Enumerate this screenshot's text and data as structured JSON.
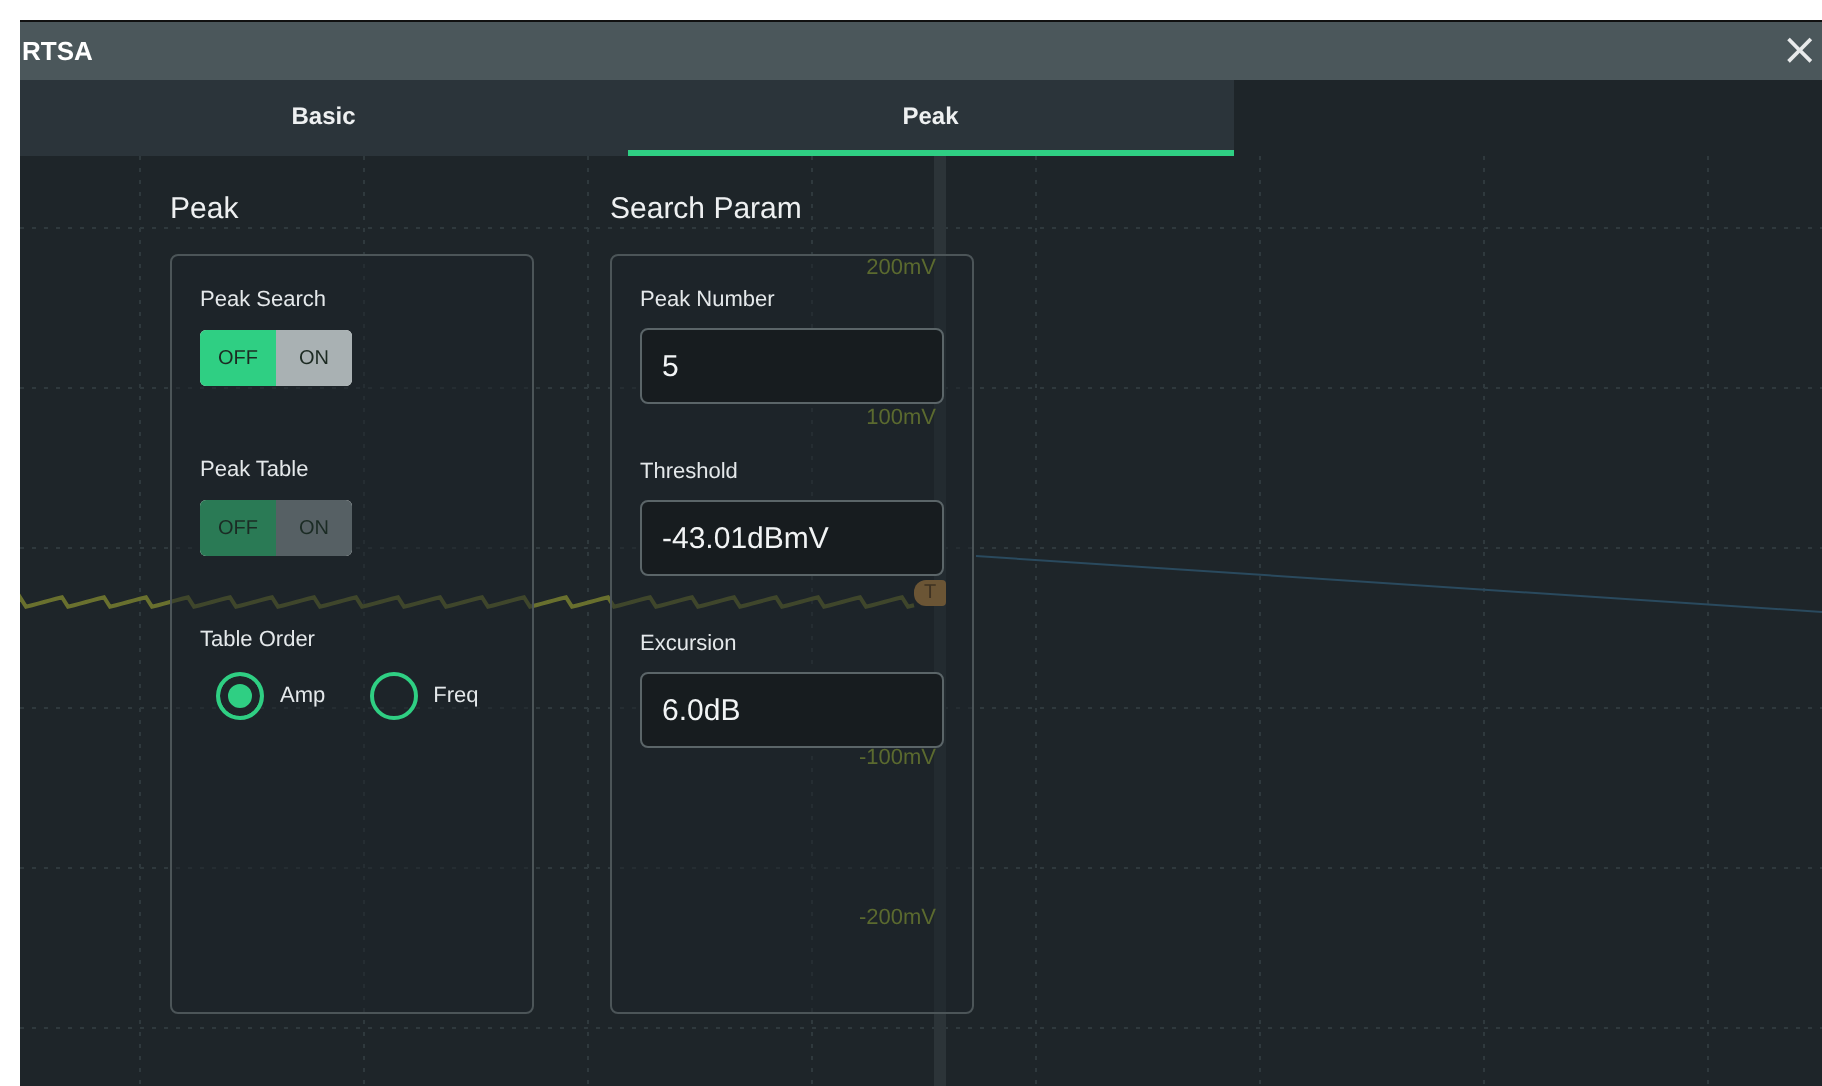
{
  "window": {
    "title": "RTSA",
    "close": "×"
  },
  "tabs": [
    {
      "label": "Basic",
      "selected": false
    },
    {
      "label": "Peak",
      "selected": true
    }
  ],
  "scope": {
    "axis_labels": [
      "200mV",
      "100mV",
      "-100mV",
      "-200mV"
    ],
    "trigger_marker": "T"
  },
  "peak_panel": {
    "heading": "Peak",
    "items": [
      {
        "kind": "toggle",
        "label": "Peak Search",
        "off_text": "OFF",
        "on_text": "ON",
        "on": false,
        "disabled": false
      },
      {
        "kind": "toggle",
        "label": "Peak Table",
        "off_text": "OFF",
        "on_text": "ON",
        "on": false,
        "disabled": true
      },
      {
        "kind": "radio",
        "label": "Table Order",
        "options": [
          {
            "label": "Amp",
            "selected": true
          },
          {
            "label": "Freq",
            "selected": false
          }
        ]
      }
    ]
  },
  "search_param": {
    "heading": "Search Param",
    "fields": [
      {
        "label": "Peak Number",
        "value": "5"
      },
      {
        "label": "Threshold",
        "value": "-43.01dBmV"
      },
      {
        "label": "Excursion",
        "value": "6.0dB"
      }
    ]
  }
}
